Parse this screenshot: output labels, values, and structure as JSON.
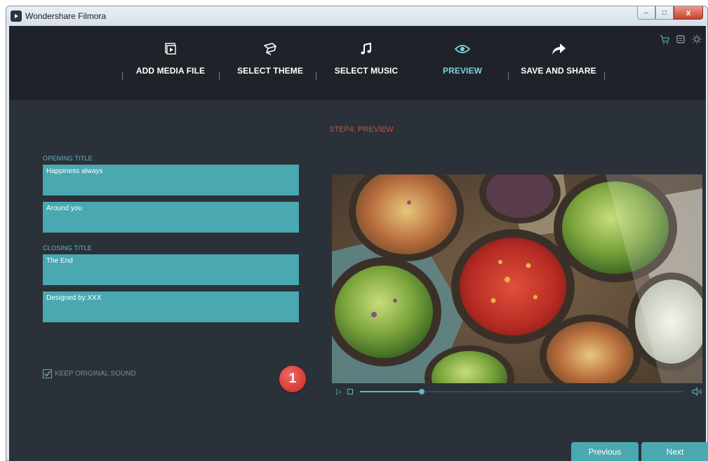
{
  "window": {
    "title": "Wondershare Filmora",
    "controls": {
      "minimize": "–",
      "maximize": "□",
      "close": "x"
    }
  },
  "nav": {
    "steps": [
      {
        "label": "ADD MEDIA FILE",
        "icon": "media-file-icon",
        "active": false
      },
      {
        "label": "SELECT THEME",
        "icon": "theme-icon",
        "active": false
      },
      {
        "label": "SELECT MUSIC",
        "icon": "music-note-icon",
        "active": false
      },
      {
        "label": "PREVIEW",
        "icon": "eye-icon",
        "active": true
      },
      {
        "label": "SAVE AND SHARE",
        "icon": "share-arrow-icon",
        "active": false
      }
    ],
    "separator": "|",
    "corner_icons": [
      "cart-icon",
      "menu-icon",
      "brightness-icon"
    ]
  },
  "main": {
    "step_title": "STEP4: PREVIEW",
    "opening_title_label": "OPENING TITLE",
    "opening_lines": [
      "Happiness always",
      "Around you"
    ],
    "closing_title_label": "CLOSING TITLE",
    "closing_lines": [
      "The End",
      "Designed by:XXX"
    ],
    "keep_sound_label": "KEEP ORIGINAL SOUND",
    "keep_sound_checked": true,
    "badge": "1"
  },
  "player": {
    "progress": 0.19,
    "play_symbol": "▷"
  },
  "buttons": {
    "previous": "Previous",
    "next": "Next"
  },
  "colors": {
    "accent": "#4aa8b1",
    "accent_text": "#7fd3dc",
    "step_title": "#c9533e",
    "panel_bg": "#2b3139",
    "nav_bg": "#1f2329",
    "badge": "#d23a33"
  }
}
